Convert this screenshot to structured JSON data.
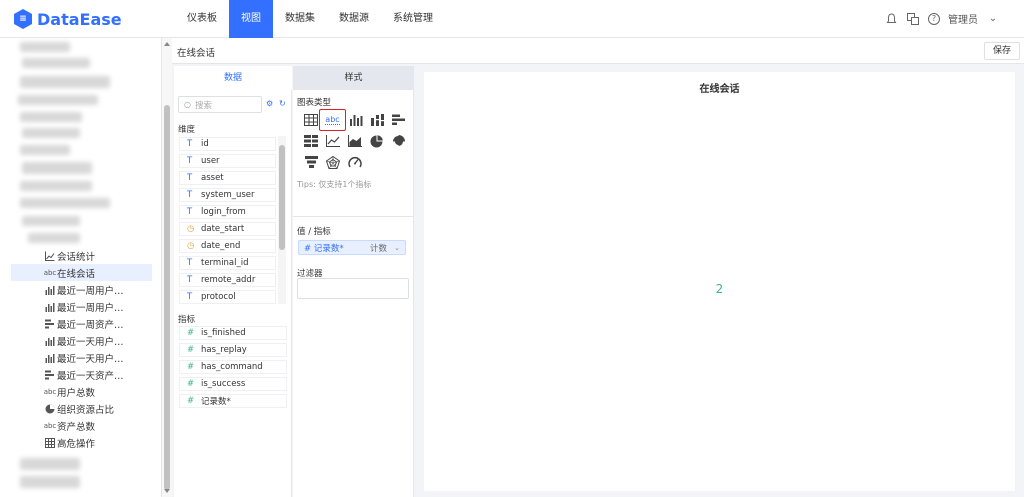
{
  "app": {
    "name": "DataEase"
  },
  "nav": {
    "items": [
      {
        "label": "仪表板",
        "active": false
      },
      {
        "label": "视图",
        "active": true
      },
      {
        "label": "数据集",
        "active": false
      },
      {
        "label": "数据源",
        "active": false
      },
      {
        "label": "系统管理",
        "active": false
      }
    ],
    "user": "管理员"
  },
  "tree": {
    "items": [
      {
        "label": "会话统计",
        "icon": "line-chart-icon"
      },
      {
        "label": "在线会话",
        "icon": "text-card-icon",
        "selected": true
      },
      {
        "label": "最近一周用户…",
        "icon": "bar-chart-icon"
      },
      {
        "label": "最近一周用户…",
        "icon": "bar-chart-icon"
      },
      {
        "label": "最近一周资产…",
        "icon": "horizontal-bar-icon"
      },
      {
        "label": "最近一天用户…",
        "icon": "bar-chart-icon"
      },
      {
        "label": "最近一天用户…",
        "icon": "bar-chart-icon"
      },
      {
        "label": "最近一天资产…",
        "icon": "horizontal-bar-icon"
      },
      {
        "label": "用户总数",
        "icon": "text-card-icon"
      },
      {
        "label": "组织资源占比",
        "icon": "pie-chart-icon"
      },
      {
        "label": "资产总数",
        "icon": "text-card-icon"
      },
      {
        "label": "高危操作",
        "icon": "table-icon"
      }
    ]
  },
  "view": {
    "title": "在线会话",
    "save_label": "保存"
  },
  "data_panel": {
    "tab_label": "数据",
    "search_placeholder": "搜索",
    "dimension_label": "维度",
    "dimensions": [
      {
        "name": "id",
        "type": "T"
      },
      {
        "name": "user",
        "type": "T"
      },
      {
        "name": "asset",
        "type": "T"
      },
      {
        "name": "system_user",
        "type": "T"
      },
      {
        "name": "login_from",
        "type": "T"
      },
      {
        "name": "date_start",
        "type": "date"
      },
      {
        "name": "date_end",
        "type": "date"
      },
      {
        "name": "terminal_id",
        "type": "T"
      },
      {
        "name": "remote_addr",
        "type": "T"
      },
      {
        "name": "protocol",
        "type": "T"
      }
    ],
    "measure_label": "指标",
    "measures": [
      {
        "name": "is_finished"
      },
      {
        "name": "has_replay"
      },
      {
        "name": "has_command"
      },
      {
        "name": "is_success"
      },
      {
        "name": "记录数*"
      }
    ]
  },
  "style_panel": {
    "tab_label": "样式",
    "chart_type_label": "图表类型",
    "tips": "Tips: 仅支持1个指标",
    "value_label": "值 / 指标",
    "value_chip": {
      "name": "# 记录数*",
      "agg": "计数"
    },
    "filter_label": "过滤器"
  },
  "canvas": {
    "title": "在线会话",
    "value": "2"
  },
  "colors": {
    "accent": "#3370ff",
    "value": "#3bb58c",
    "selected_border": "#e02020"
  }
}
